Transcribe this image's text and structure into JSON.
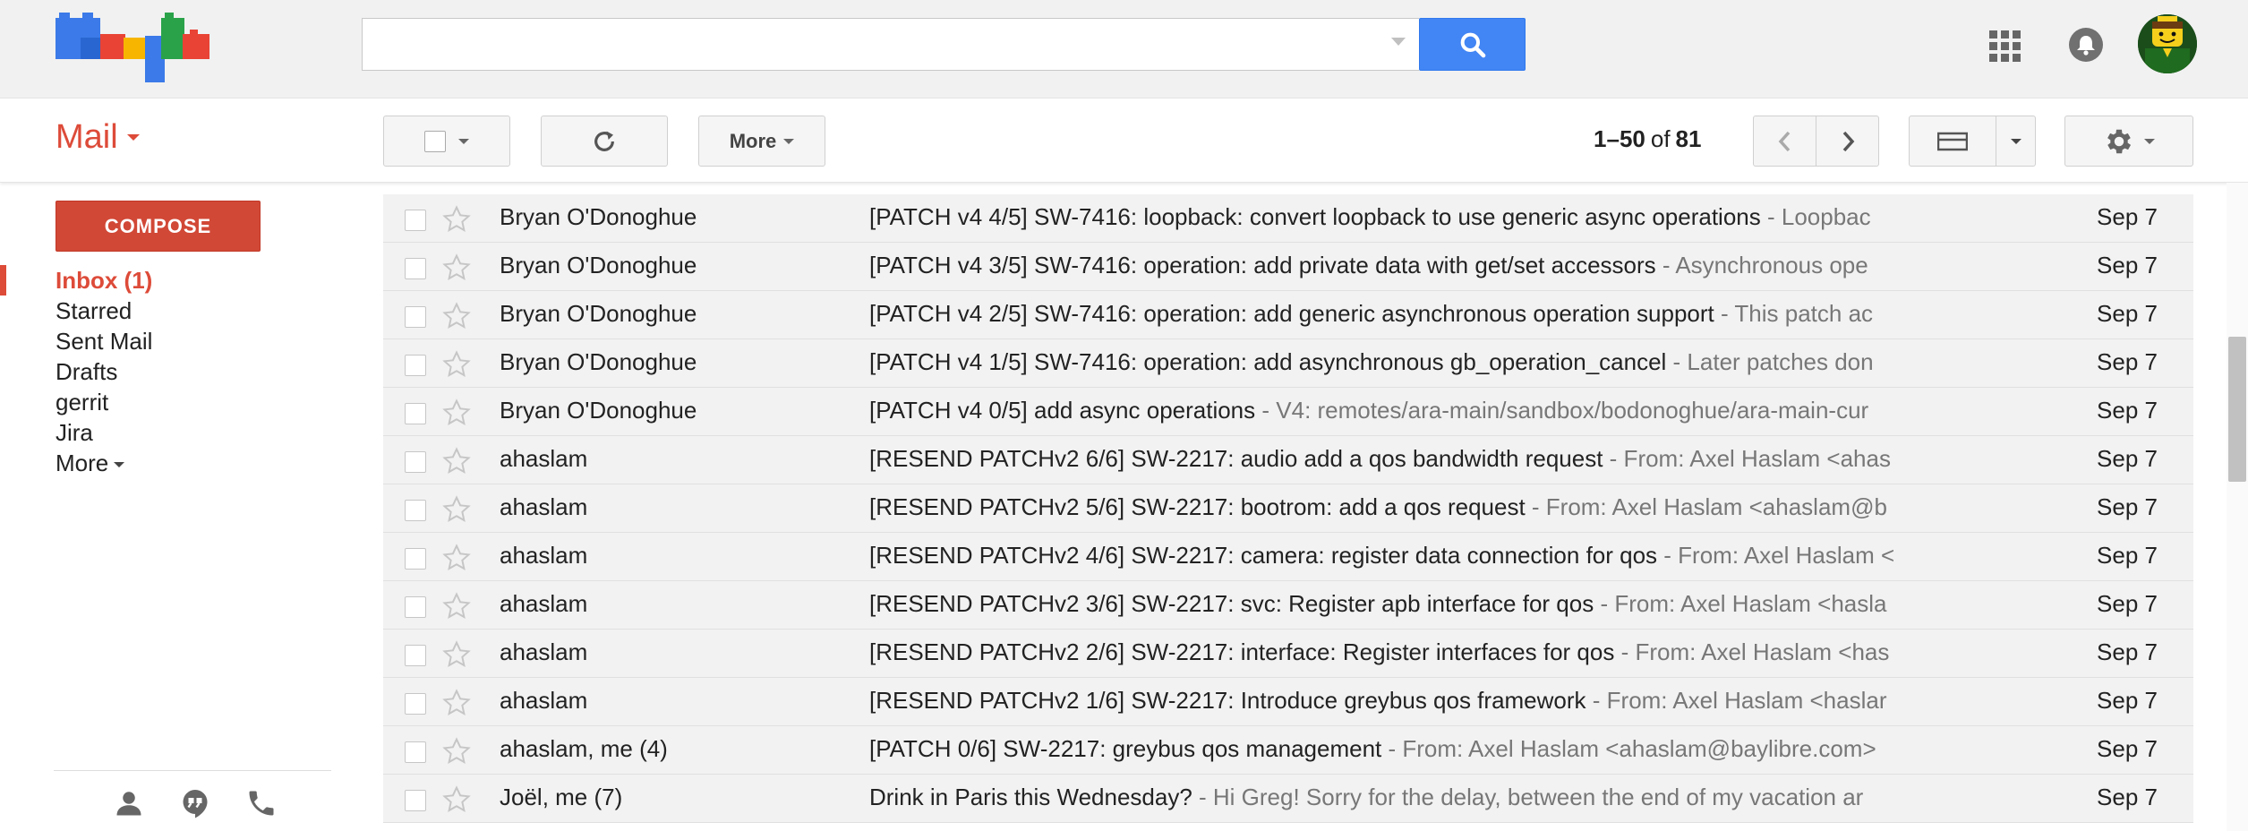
{
  "header": {
    "logo_icon": "lego-google-logo",
    "search": {
      "value": "",
      "placeholder": ""
    },
    "search_button_icon": "search-icon",
    "apps_icon": "apps-grid-icon",
    "notifications_icon": "bell-icon",
    "avatar_icon": "lego-avatar"
  },
  "toolbar": {
    "mail_label": "Mail",
    "select_icon": "checkbox-icon",
    "refresh_icon": "refresh-icon",
    "more_label": "More",
    "range_start": "1",
    "range_end": "50",
    "range_of": "of",
    "total": "81",
    "range_dash": "–",
    "prev_icon": "chevron-left-icon",
    "next_icon": "chevron-right-icon",
    "density_icon": "split-pane-icon",
    "settings_icon": "gear-icon"
  },
  "sidebar": {
    "compose_label": "COMPOSE",
    "items": [
      {
        "label": "Inbox (1)",
        "active": true
      },
      {
        "label": "Starred"
      },
      {
        "label": "Sent Mail"
      },
      {
        "label": "Drafts"
      },
      {
        "label": "gerrit"
      },
      {
        "label": "Jira"
      },
      {
        "label": "More"
      }
    ],
    "bottom_icons": [
      "person-icon",
      "hangouts-icon",
      "phone-icon"
    ]
  },
  "messages": [
    {
      "sender": "Bryan O'Donoghue",
      "subject": "[PATCH v4 4/5] SW-7416: loopback: convert loopback to use generic async operations",
      "snippet": " - Loopbac",
      "date": "Sep 7"
    },
    {
      "sender": "Bryan O'Donoghue",
      "subject": "[PATCH v4 3/5] SW-7416: operation: add private data with get/set accessors",
      "snippet": " - Asynchronous ope",
      "date": "Sep 7"
    },
    {
      "sender": "Bryan O'Donoghue",
      "subject": "[PATCH v4 2/5] SW-7416: operation: add generic asynchronous operation support",
      "snippet": " - This patch ac",
      "date": "Sep 7"
    },
    {
      "sender": "Bryan O'Donoghue",
      "subject": "[PATCH v4 1/5] SW-7416: operation: add asynchronous gb_operation_cancel",
      "snippet": " - Later patches don",
      "date": "Sep 7"
    },
    {
      "sender": "Bryan O'Donoghue",
      "subject": "[PATCH v4 0/5] add async operations",
      "snippet": " - V4: remotes/ara-main/sandbox/bodonoghue/ara-main-cur",
      "date": "Sep 7"
    },
    {
      "sender": "ahaslam",
      "subject": "[RESEND PATCHv2 6/6] SW-2217: audio add a qos bandwidth request",
      "snippet": " - From: Axel Haslam <ahas",
      "date": "Sep 7"
    },
    {
      "sender": "ahaslam",
      "subject": "[RESEND PATCHv2 5/6] SW-2217: bootrom: add a qos request",
      "snippet": " - From: Axel Haslam <ahaslam@b",
      "date": "Sep 7"
    },
    {
      "sender": "ahaslam",
      "subject": "[RESEND PATCHv2 4/6] SW-2217: camera: register data connection for qos",
      "snippet": " - From: Axel Haslam <",
      "date": "Sep 7"
    },
    {
      "sender": "ahaslam",
      "subject": "[RESEND PATCHv2 3/6] SW-2217: svc: Register apb interface for qos",
      "snippet": " - From: Axel Haslam <hasla",
      "date": "Sep 7"
    },
    {
      "sender": "ahaslam",
      "subject": "[RESEND PATCHv2 2/6] SW-2217: interface: Register interfaces for qos",
      "snippet": " - From: Axel Haslam <has",
      "date": "Sep 7"
    },
    {
      "sender": "ahaslam",
      "subject": "[RESEND PATCHv2 1/6] SW-2217: Introduce greybus qos framework",
      "snippet": " - From: Axel Haslam <haslar",
      "date": "Sep 7"
    },
    {
      "sender": "ahaslam, me (4)",
      "subject": "[PATCH 0/6] SW-2217: greybus qos management",
      "snippet": " - From: Axel Haslam <ahaslam@baylibre.com>",
      "date": "Sep 7"
    },
    {
      "sender": "Joël, me (7)",
      "subject": "Drink in Paris this Wednesday?",
      "snippet": " - Hi Greg! Sorry for the delay, between the end of my vacation ar",
      "date": "Sep 7"
    }
  ],
  "colors": {
    "accent": "#dd4b39",
    "search_button": "#4285f4",
    "compose": "#d14836",
    "row_bg": "#f2f2f2"
  }
}
